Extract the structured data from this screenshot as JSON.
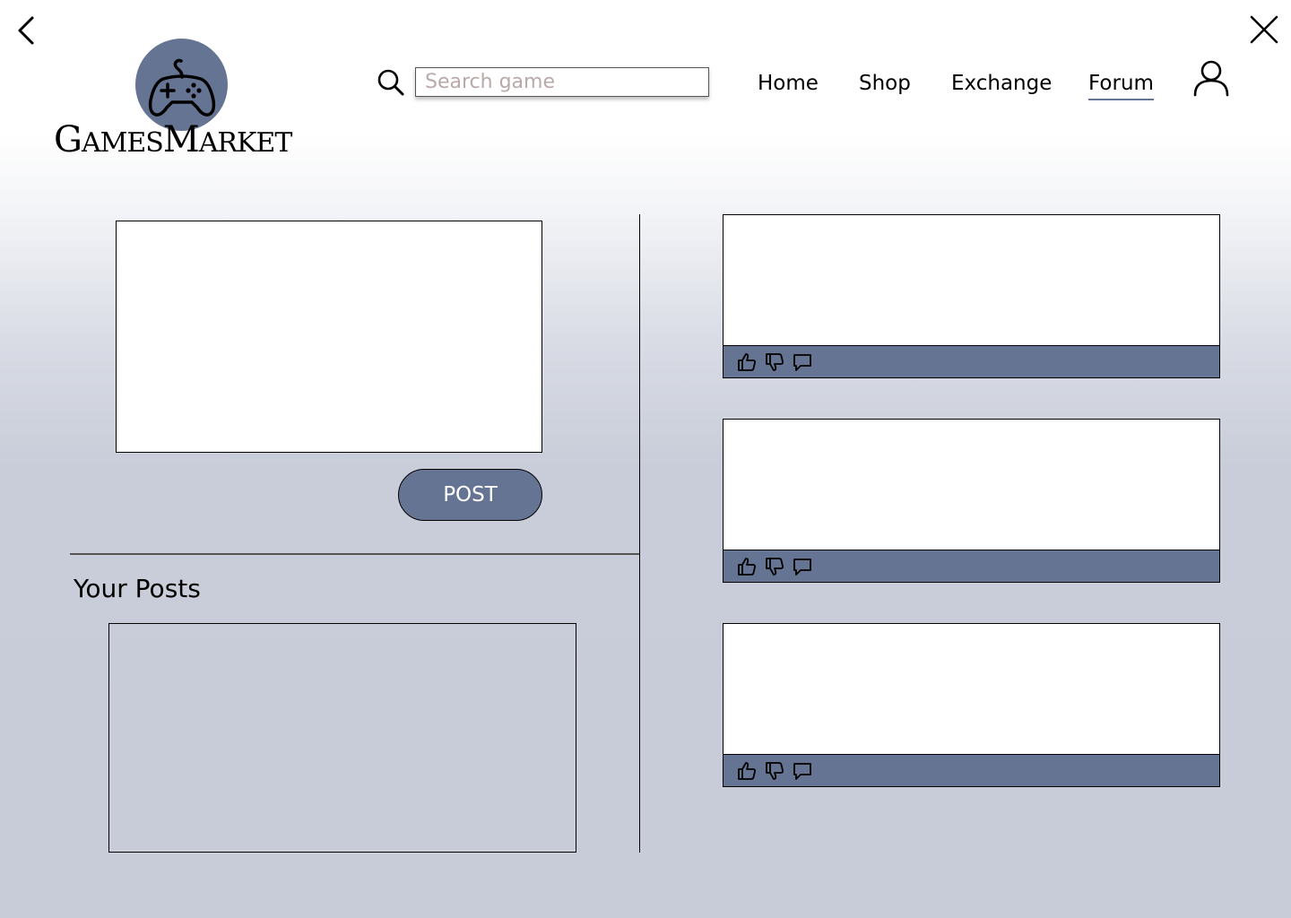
{
  "logo": {
    "name_parts": [
      "G",
      "AMES",
      "M",
      "ARKET"
    ]
  },
  "search": {
    "placeholder": "Search game",
    "value": ""
  },
  "nav": {
    "items": [
      {
        "label": "Home"
      },
      {
        "label": "Shop"
      },
      {
        "label": "Exchange"
      },
      {
        "label": "Forum",
        "active": true
      }
    ]
  },
  "compose": {
    "text": "",
    "post_label": "POST"
  },
  "your_posts": {
    "title": "Your Posts"
  },
  "feed": {
    "posts": [
      {
        "content": "",
        "actions": [
          "thumbs-up-icon",
          "thumbs-down-icon",
          "comment-icon"
        ]
      },
      {
        "content": "",
        "actions": [
          "thumbs-up-icon",
          "thumbs-down-icon",
          "comment-icon"
        ]
      },
      {
        "content": "",
        "actions": [
          "thumbs-up-icon",
          "thumbs-down-icon",
          "comment-icon"
        ]
      }
    ]
  },
  "icons": {
    "back": "chevron-left-icon",
    "close": "close-icon",
    "search": "search-icon",
    "user": "user-icon",
    "logo": "gamepad-icon"
  },
  "colors": {
    "accent": "#667493",
    "background_top": "#ffffff",
    "background_bottom": "#c8ccd8",
    "search_placeholder": "#b9a9a9"
  }
}
